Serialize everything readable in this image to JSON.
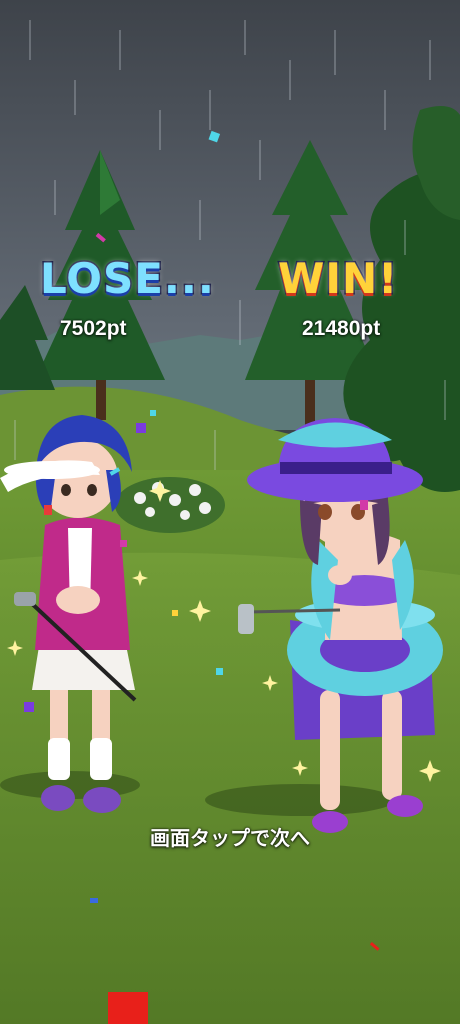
{
  "result": {
    "player1": {
      "label": "LOSE...",
      "score": "7502pt"
    },
    "player2": {
      "label": "WIN!",
      "score": "21480pt"
    }
  },
  "prompt": "画面タップで次へ",
  "colors": {
    "sky": "#4a5058",
    "grass": "#5f8a2e",
    "lose_text": "#7ee0ff",
    "win_text": "#ffd23a",
    "player1_outfit": "#c02a8a",
    "player2_outfit": "#6a3fc8",
    "player2_float": "#5fd0e0"
  }
}
